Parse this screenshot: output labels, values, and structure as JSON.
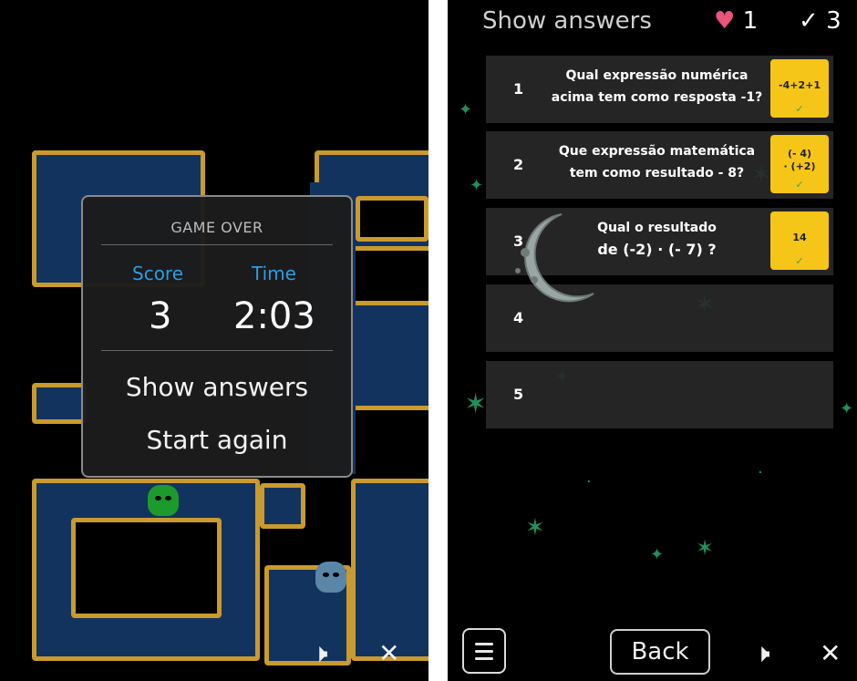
{
  "game_over_screen": {
    "modal": {
      "title": "GAME OVER",
      "score_label": "Score",
      "time_label": "Time",
      "score_value": "3",
      "time_value": "2:03",
      "show_answers_label": "Show answers",
      "start_again_label": "Start again"
    },
    "controls": {
      "sound_icon": "speaker-icon",
      "close_icon": "close-icon",
      "sound_glyph": "🕨",
      "close_glyph": "✕"
    }
  },
  "answers_screen": {
    "title": "Show answers",
    "hearts": "1",
    "checks": "3",
    "heart_glyph": "♥",
    "check_glyph": "✓",
    "questions": [
      {
        "number": "1",
        "text_line1": "Qual expressão numérica",
        "text_line2": "acima tem como resposta -1?",
        "answer_line1": "-4+2+1",
        "answer_line2": "",
        "correct": true
      },
      {
        "number": "2",
        "text_line1": "Que expressão matemática",
        "text_line2": "tem como resultado - 8?",
        "answer_line1": "(- 4)",
        "answer_line2": "· (+2)",
        "correct": true
      },
      {
        "number": "3",
        "text_line1": "Qual o resultado",
        "text_line2": "de (-2) · (- 7) ?",
        "answer_line1": "14",
        "answer_line2": "",
        "correct": true
      },
      {
        "number": "4",
        "text_line1": "",
        "text_line2": "",
        "answer_line1": "",
        "answer_line2": ""
      },
      {
        "number": "5",
        "text_line1": "",
        "text_line2": "",
        "answer_line1": "",
        "answer_line2": ""
      }
    ],
    "back_label": "Back",
    "menu_icon": "hamburger-menu-icon",
    "controls": {
      "sound_icon": "speaker-icon",
      "close_icon": "close-icon",
      "sound_glyph": "🕨",
      "close_glyph": "✕"
    }
  },
  "colors": {
    "score_accent": "#2e9de0",
    "answer_box": "#f5c518",
    "maze_wall": "#c99a2e",
    "maze_floor": "#13335f",
    "heart": "#e8547a"
  }
}
